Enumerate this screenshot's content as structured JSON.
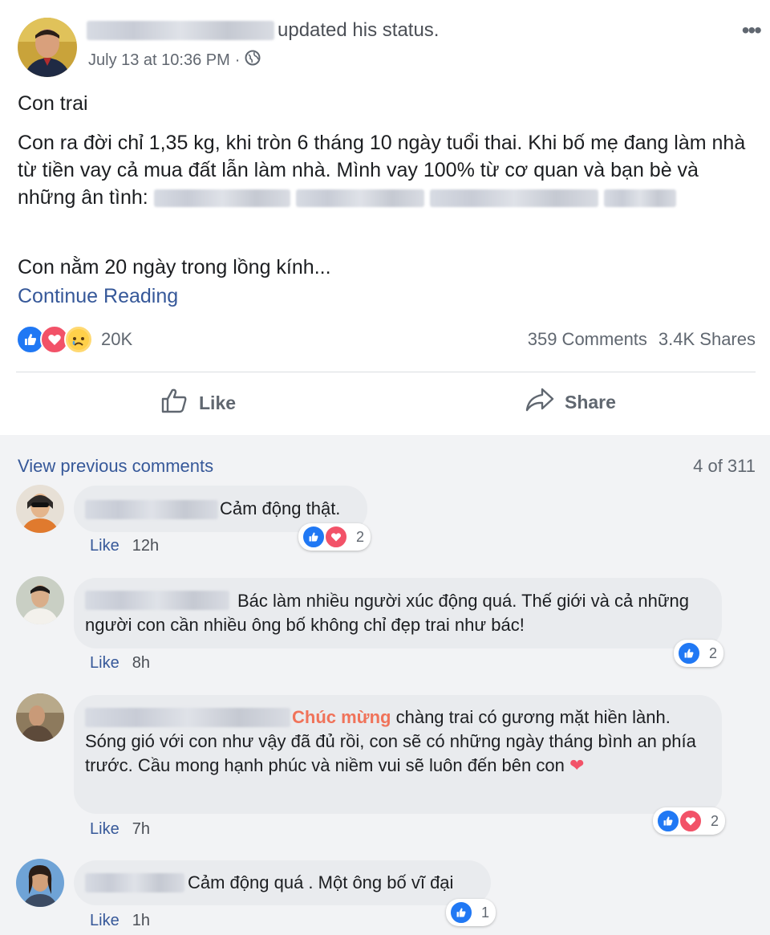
{
  "post": {
    "action_text": "updated his status.",
    "timestamp": "July 13 at 10:36 PM",
    "separator": "·",
    "more_label": "•••",
    "title": "Con trai",
    "para1": "Con ra đời chỉ 1,35 kg, khi tròn 6 tháng 10 ngày tuổi thai. Khi bố mẹ đang làm nhà từ tiền vay cả mua đất lẫn làm nhà. Mình vay 100% từ cơ quan và bạn bè và những ân tình:",
    "para2": "Con nằm 20 ngày trong lồng kính...",
    "continue_reading": "Continue Reading",
    "reaction_count": "20K",
    "comments_count": "359 Comments",
    "shares_count": "3.4K Shares",
    "like_label": "Like",
    "share_label": "Share"
  },
  "comments_section": {
    "view_previous": "View previous comments",
    "pager": "4 of 311",
    "items": [
      {
        "text": "Cảm động thật.",
        "like": "Like",
        "time": "12h",
        "reaction_count": "2"
      },
      {
        "text": "Bác làm nhiều người xúc động quá. Thế giới và cả những người con cần nhiều ông bố không chỉ đẹp trai như bác!",
        "like": "Like",
        "time": "8h",
        "reaction_count": "2"
      },
      {
        "highlight": "Chúc mừng",
        "text": " chàng trai có gương mặt hiền lành. Sóng gió với con như vậy đã đủ rồi, con sẽ có những ngày tháng bình an phía trước. Cầu mong hạnh phúc và niềm vui sẽ luôn đến bên con",
        "like": "Like",
        "time": "7h",
        "reaction_count": "2"
      },
      {
        "text": "Cảm động quá . Một ông bố vĩ đại",
        "like": "Like",
        "time": "1h",
        "reaction_count": "1"
      }
    ]
  },
  "icons": {
    "like": "like-icon",
    "love": "love-icon",
    "sad": "sad-icon",
    "globe": "globe-icon",
    "thumb_outline": "thumb-outline-icon",
    "share_arrow": "share-arrow-icon",
    "heart_emoji": "heart-emoji"
  },
  "colors": {
    "link": "#365899",
    "like_blue": "#2078f4",
    "love_red": "#f25268",
    "highlight": "#f0735a",
    "bubble": "#e9ebee"
  }
}
